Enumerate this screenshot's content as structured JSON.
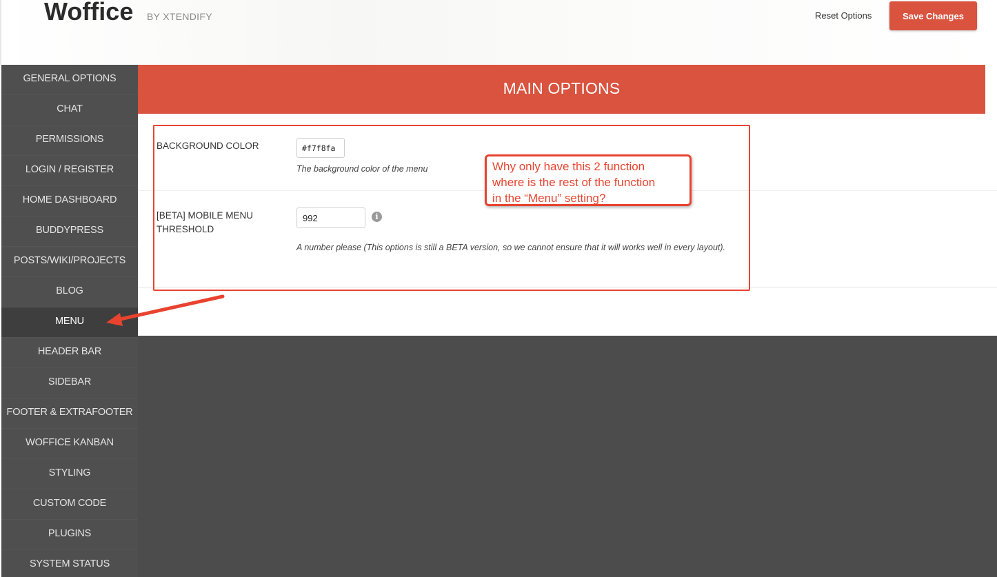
{
  "header": {
    "logo": "Woffice",
    "byline": "BY XTENDIFY",
    "reset_label": "Reset Options",
    "save_label": "Save Changes"
  },
  "sidebar": {
    "items": [
      {
        "label": "GENERAL OPTIONS"
      },
      {
        "label": "CHAT"
      },
      {
        "label": "PERMISSIONS"
      },
      {
        "label": "LOGIN / REGISTER"
      },
      {
        "label": "HOME DASHBOARD"
      },
      {
        "label": "BUDDYPRESS"
      },
      {
        "label": "POSTS/WIKI/PROJECTS"
      },
      {
        "label": "BLOG"
      },
      {
        "label": "MENU"
      },
      {
        "label": "HEADER BAR"
      },
      {
        "label": "SIDEBAR"
      },
      {
        "label": "FOOTER & EXTRAFOOTER"
      },
      {
        "label": "WOFFICE KANBAN"
      },
      {
        "label": "STYLING"
      },
      {
        "label": "CUSTOM CODE"
      },
      {
        "label": "PLUGINS"
      },
      {
        "label": "SYSTEM STATUS"
      }
    ],
    "active": "MENU"
  },
  "main": {
    "title": "MAIN OPTIONS",
    "options": [
      {
        "label": "BACKGROUND COLOR",
        "value": "#f7f8fa",
        "description": "The background color of the menu"
      },
      {
        "label_line1": "[BETA] MOBILE MENU",
        "label_line2": "THRESHOLD",
        "value": "992",
        "description": "A number please (This options is still a BETA version, so we cannot ensure that it will works well in every layout)."
      }
    ]
  },
  "annotation": {
    "line1": "Why only have this 2 function",
    "line2": "where is the rest of the function",
    "line3": "in the “Menu” setting?"
  },
  "colors": {
    "accent": "#d9533f",
    "annotation": "#e8432f",
    "sidebar": "#4f4f4f"
  }
}
